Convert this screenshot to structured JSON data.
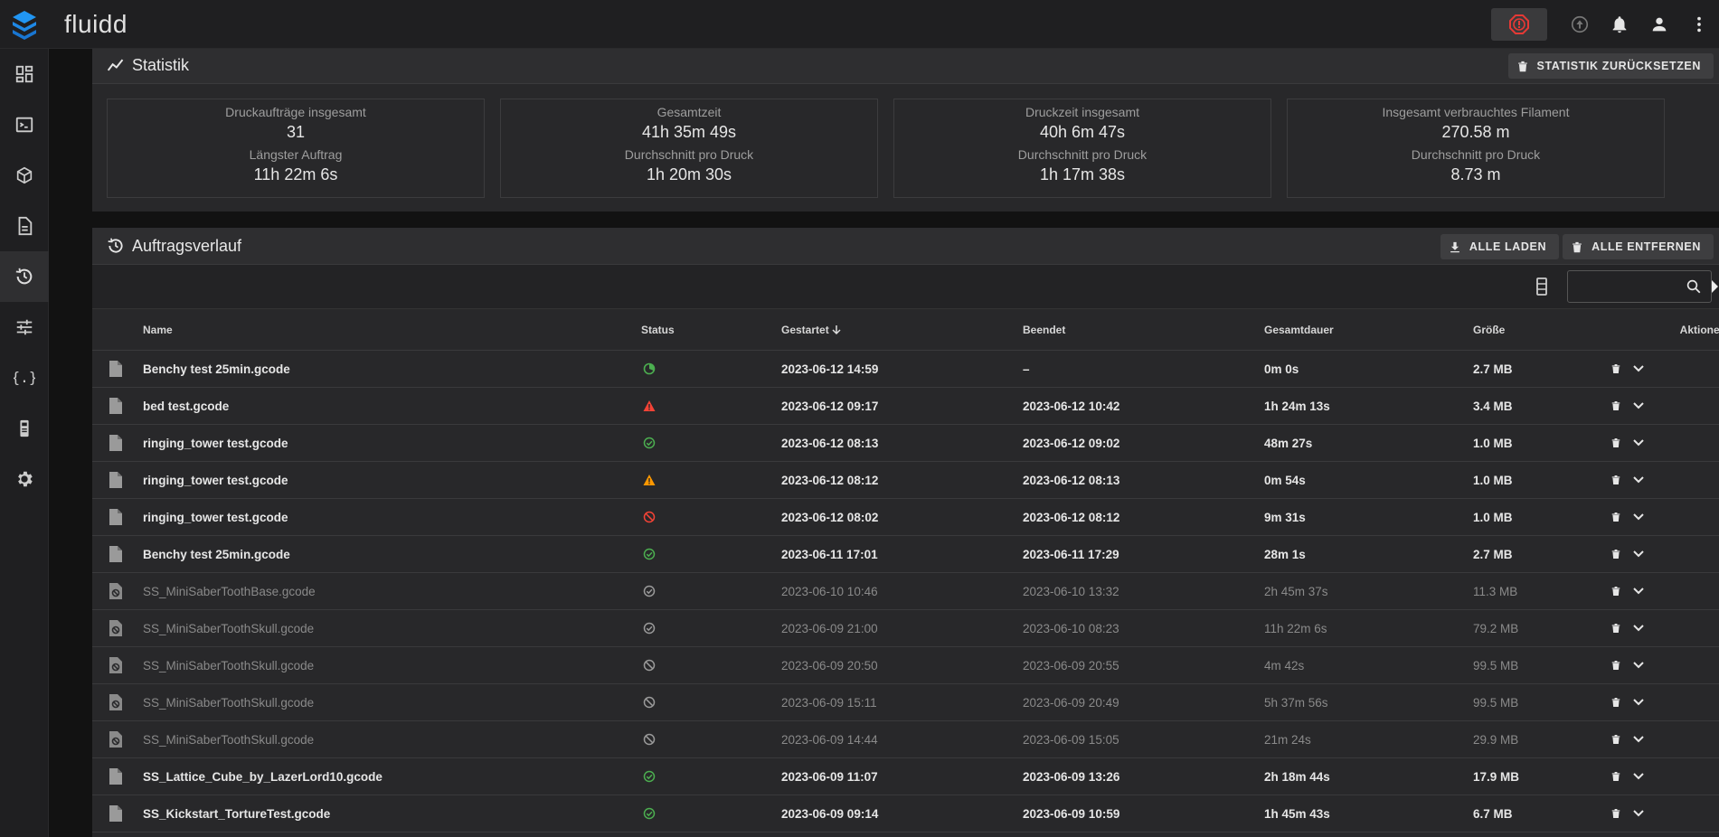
{
  "app": {
    "title": "fluidd"
  },
  "colors": {
    "accent": "#2196f3",
    "success": "#4caf50",
    "error": "#f44336",
    "warning": "#ff9800",
    "estop": "#e53935"
  },
  "appbar_icons": [
    "emergency-stop-icon",
    "upload-icon",
    "bell-icon",
    "account-icon",
    "more-vert-icon"
  ],
  "sidebar": {
    "items": [
      {
        "icon": "dashboard-icon"
      },
      {
        "icon": "console-icon"
      },
      {
        "icon": "cube-icon"
      },
      {
        "icon": "jobs-icon"
      },
      {
        "icon": "history-icon",
        "active": true
      },
      {
        "icon": "tune-icon"
      },
      {
        "icon": "code-braces-icon"
      },
      {
        "icon": "printer-icon"
      },
      {
        "icon": "settings-icon"
      }
    ]
  },
  "statistics": {
    "title": "Statistik",
    "reset_label": "STATISTIK ZURÜCKSETZEN",
    "boxes": [
      {
        "label1": "Druckaufträge insgesamt",
        "value1": "31",
        "label2": "Längster Auftrag",
        "value2": "11h 22m 6s"
      },
      {
        "label1": "Gesamtzeit",
        "value1": "41h 35m 49s",
        "label2": "Durchschnitt pro Druck",
        "value2": "1h 20m 30s"
      },
      {
        "label1": "Druckzeit insgesamt",
        "value1": "40h 6m 47s",
        "label2": "Durchschnitt pro Druck",
        "value2": "1h 17m 38s"
      },
      {
        "label1": "Insgesamt verbrauchtes Filament",
        "value1": "270.58 m",
        "label2": "Durchschnitt pro Druck",
        "value2": "8.73 m"
      }
    ]
  },
  "history": {
    "title": "Auftragsverlauf",
    "load_all_label": "ALLE LADEN",
    "remove_all_label": "ALLE ENTFERNEN",
    "search_placeholder": "",
    "columns": {
      "name": "Name",
      "status": "Status",
      "started": "Gestartet",
      "ended": "Beendet",
      "duration": "Gesamtdauer",
      "size": "Größe",
      "actions": "Aktionen"
    },
    "rows": [
      {
        "name": "Benchy test 25min.gcode",
        "status": "in-progress",
        "started": "2023-06-12 14:59",
        "ended": "–",
        "duration": "0m 0s",
        "size": "2.7 MB",
        "dim": false
      },
      {
        "name": "bed test.gcode",
        "status": "error",
        "started": "2023-06-12 09:17",
        "ended": "2023-06-12 10:42",
        "duration": "1h 24m 13s",
        "size": "3.4 MB",
        "dim": false
      },
      {
        "name": "ringing_tower test.gcode",
        "status": "completed",
        "started": "2023-06-12 08:13",
        "ended": "2023-06-12 09:02",
        "duration": "48m 27s",
        "size": "1.0 MB",
        "dim": false
      },
      {
        "name": "ringing_tower test.gcode",
        "status": "warning",
        "started": "2023-06-12 08:12",
        "ended": "2023-06-12 08:13",
        "duration": "0m 54s",
        "size": "1.0 MB",
        "dim": false
      },
      {
        "name": "ringing_tower test.gcode",
        "status": "cancelled",
        "started": "2023-06-12 08:02",
        "ended": "2023-06-12 08:12",
        "duration": "9m 31s",
        "size": "1.0 MB",
        "dim": false
      },
      {
        "name": "Benchy test 25min.gcode",
        "status": "completed",
        "started": "2023-06-11 17:01",
        "ended": "2023-06-11 17:29",
        "duration": "28m 1s",
        "size": "2.7 MB",
        "dim": false
      },
      {
        "name": "SS_MiniSaberToothBase.gcode",
        "status": "completed",
        "started": "2023-06-10 10:46",
        "ended": "2023-06-10 13:32",
        "duration": "2h 45m 37s",
        "size": "11.3 MB",
        "dim": true
      },
      {
        "name": "SS_MiniSaberToothSkull.gcode",
        "status": "completed",
        "started": "2023-06-09 21:00",
        "ended": "2023-06-10 08:23",
        "duration": "11h 22m 6s",
        "size": "79.2 MB",
        "dim": true
      },
      {
        "name": "SS_MiniSaberToothSkull.gcode",
        "status": "cancelled",
        "started": "2023-06-09 20:50",
        "ended": "2023-06-09 20:55",
        "duration": "4m 42s",
        "size": "99.5 MB",
        "dim": true
      },
      {
        "name": "SS_MiniSaberToothSkull.gcode",
        "status": "cancelled",
        "started": "2023-06-09 15:11",
        "ended": "2023-06-09 20:49",
        "duration": "5h 37m 56s",
        "size": "99.5 MB",
        "dim": true
      },
      {
        "name": "SS_MiniSaberToothSkull.gcode",
        "status": "cancelled",
        "started": "2023-06-09 14:44",
        "ended": "2023-06-09 15:05",
        "duration": "21m 24s",
        "size": "29.9 MB",
        "dim": true
      },
      {
        "name": "SS_Lattice_Cube_by_LazerLord10.gcode",
        "status": "completed",
        "started": "2023-06-09 11:07",
        "ended": "2023-06-09 13:26",
        "duration": "2h 18m 44s",
        "size": "17.9 MB",
        "dim": false
      },
      {
        "name": "SS_Kickstart_TortureTest.gcode",
        "status": "completed",
        "started": "2023-06-09 09:14",
        "ended": "2023-06-09 10:59",
        "duration": "1h 45m 43s",
        "size": "6.7 MB",
        "dim": false
      }
    ]
  }
}
